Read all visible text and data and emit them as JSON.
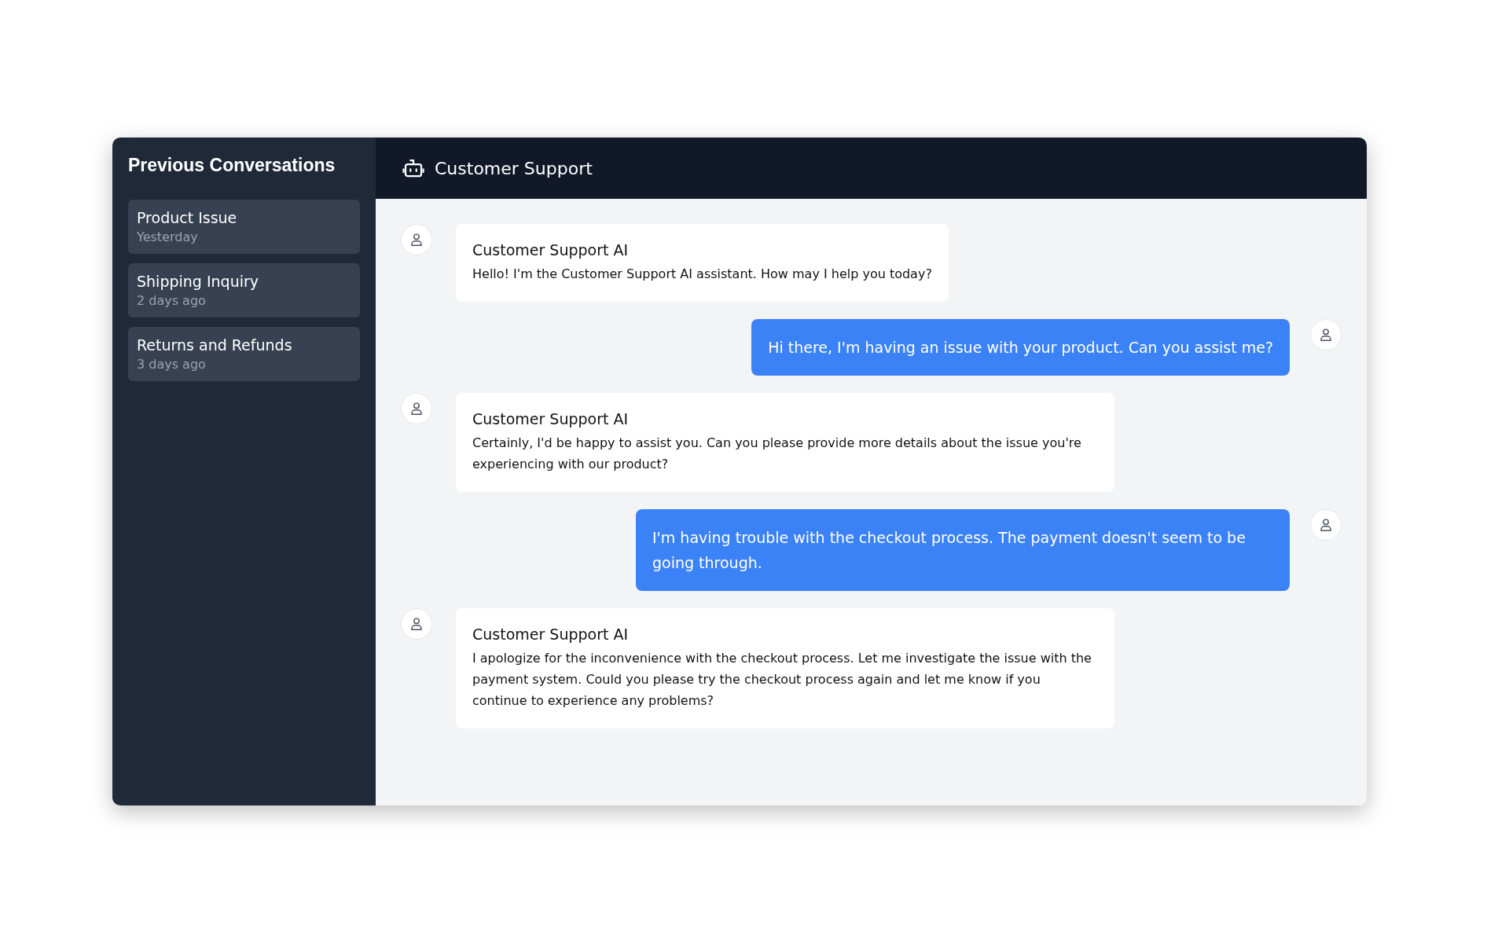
{
  "sidebar": {
    "title": "Previous Conversations",
    "items": [
      {
        "title": "Product Issue",
        "time": "Yesterday"
      },
      {
        "title": "Shipping Inquiry",
        "time": "2 days ago"
      },
      {
        "title": "Returns and Refunds",
        "time": "3 days ago"
      }
    ]
  },
  "header": {
    "title": "Customer Support"
  },
  "messages": [
    {
      "kind": "bot",
      "sender": "Customer Support AI",
      "text": "Hello! I'm the Customer Support AI assistant. How may I help you today?"
    },
    {
      "kind": "user",
      "text": "Hi there, I'm having an issue with your product. Can you assist me?"
    },
    {
      "kind": "bot",
      "sender": "Customer Support AI",
      "text": "Certainly, I'd be happy to assist you. Can you please provide more details about the issue you're experiencing with our product?"
    },
    {
      "kind": "user",
      "text": "I'm having trouble with the checkout process. The payment doesn't seem to be going through."
    },
    {
      "kind": "bot",
      "sender": "Customer Support AI",
      "text": "I apologize for the inconvenience with the checkout process. Let me investigate the issue with the payment system. Could you please try the checkout process again and let me know if you continue to experience any problems?"
    }
  ]
}
